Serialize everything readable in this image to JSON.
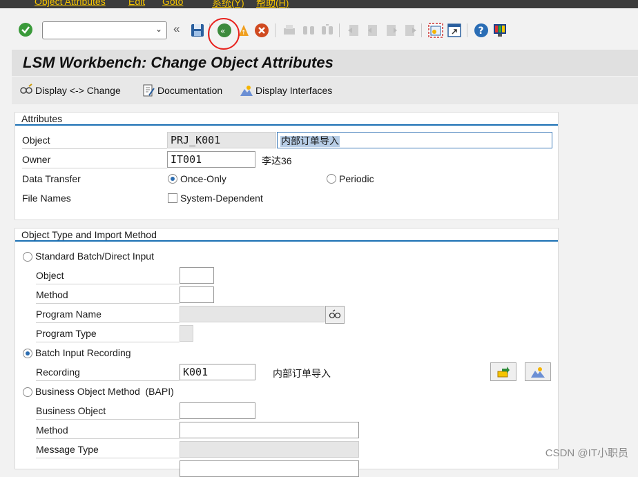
{
  "menubar": {
    "items": [
      "Object Attributes",
      "Edit",
      "Goto",
      "系统(Y)",
      "帮助(H)"
    ]
  },
  "toolbar": {
    "command_value": "",
    "icons": [
      "enter-icon",
      "back-icon",
      "save-icon",
      "back-green-icon",
      "exit-icon",
      "cancel-icon",
      "print-icon",
      "find-icon",
      "find-next-icon",
      "first-page-icon",
      "previous-page-icon",
      "next-page-icon",
      "last-page-icon",
      "new-session-icon",
      "shortcut-icon",
      "help-icon",
      "layout-icon"
    ]
  },
  "title": "LSM Workbench: Change Object Attributes",
  "appbar": {
    "display_change": "Display <-> Change",
    "documentation": "Documentation",
    "display_interfaces": "Display Interfaces"
  },
  "attributes": {
    "section_title": "Attributes",
    "object_label": "Object",
    "object_value": "PRJ_K001",
    "object_desc": "内部订单导入",
    "owner_label": "Owner",
    "owner_value": "IT001",
    "owner_name": "李达36",
    "data_transfer_label": "Data Transfer",
    "once_only": "Once-Only",
    "periodic": "Periodic",
    "file_names_label": "File Names",
    "system_dependent": "System-Dependent"
  },
  "import_method": {
    "section_title": "Object Type and Import Method",
    "standard_batch": "Standard Batch/Direct Input",
    "sb_object_label": "Object",
    "sb_method_label": "Method",
    "program_name_label": "Program Name",
    "program_type_label": "Program Type",
    "batch_input": "Batch Input Recording",
    "recording_label": "Recording",
    "recording_value": "K001",
    "recording_desc": "内部订单导入",
    "bapi": "Business Object Method  (BAPI)",
    "business_object_label": "Business Object",
    "bapi_method_label": "Method",
    "message_type_label": "Message Type"
  },
  "watermark": "CSDN @IT小职员",
  "colors": {
    "accent": "#1a6fb3",
    "highlight_circle": "#e8231f",
    "menu_text": "#f5c400"
  }
}
